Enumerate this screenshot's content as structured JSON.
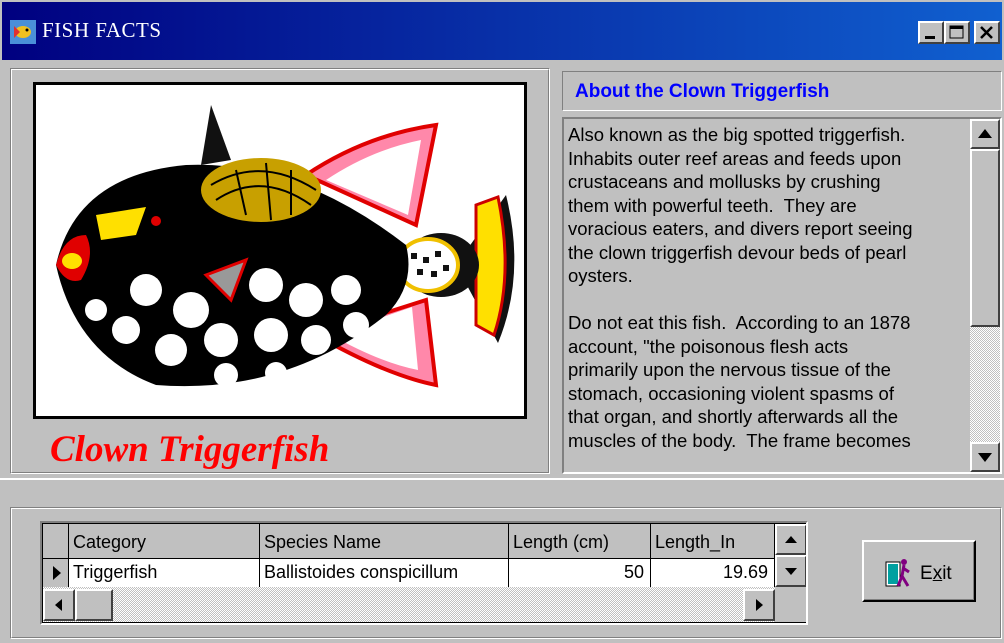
{
  "window": {
    "title": "FISH FACTS",
    "controls": [
      "minimize",
      "maximize",
      "close"
    ]
  },
  "picture": {
    "icon": "clown-triggerfish-illustration"
  },
  "species_caption": "Clown Triggerfish",
  "about": {
    "title": "About the Clown Triggerfish",
    "text": "Also known as the big spotted triggerfish.\nInhabits outer reef areas and feeds upon\ncrustaceans and mollusks by crushing\nthem with powerful teeth.  They are\nvoracious eaters, and divers report seeing\nthe clown triggerfish devour beds of pearl\noysters.\n\nDo not eat this fish.  According to an 1878\naccount, \"the poisonous flesh acts\nprimarily upon the nervous tissue of the\nstomach, occasioning violent spasms of\nthat organ, and shortly afterwards all the\nmuscles of the body.  The frame becomes"
  },
  "grid": {
    "columns": [
      "Category",
      "Species Name",
      "Length (cm)",
      "Length_In"
    ],
    "rows": [
      [
        "Triggerfish",
        "Ballistoides conspicillum",
        "50",
        "19.69"
      ]
    ]
  },
  "exit_button": {
    "label_prefix": "E",
    "label_underlined": "x",
    "label_suffix": "it",
    "icon": "exit-door-icon"
  }
}
